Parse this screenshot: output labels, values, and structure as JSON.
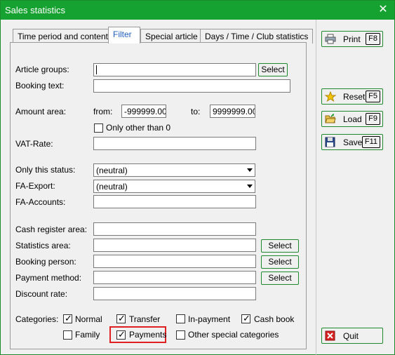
{
  "window": {
    "title": "Sales statistics"
  },
  "tabs": [
    {
      "label": "Time period and content"
    },
    {
      "label": "Filter"
    },
    {
      "label": "Special article"
    },
    {
      "label": "Days / Time / Club statistics"
    }
  ],
  "filter": {
    "article_groups_label": "Article groups:",
    "article_groups_value": "",
    "booking_text_label": "Booking text:",
    "booking_text_value": "",
    "amount_area_label": "Amount area:",
    "from_label": "from:",
    "from_value": "-999999.00",
    "to_label": "to:",
    "to_value": "9999999.00",
    "only_other_than_0_label": "Only other than 0",
    "vat_rate_label": "VAT-Rate:",
    "vat_rate_value": "",
    "only_this_status_label": "Only this status:",
    "only_this_status_value": "(neutral)",
    "fa_export_label": "FA-Export:",
    "fa_export_value": "(neutral)",
    "fa_accounts_label": "FA-Accounts:",
    "fa_accounts_value": "",
    "cash_register_label": "Cash register area:",
    "cash_register_value": "",
    "statistics_area_label": "Statistics area:",
    "statistics_area_value": "",
    "booking_person_label": "Booking person:",
    "booking_person_value": "",
    "payment_method_label": "Payment method:",
    "payment_method_value": "",
    "discount_rate_label": "Discount rate:",
    "discount_rate_value": "",
    "select_label": "Select",
    "categories_label": "Categories:",
    "categories": [
      {
        "label": "Normal",
        "checked": true
      },
      {
        "label": "Transfer",
        "checked": true
      },
      {
        "label": "In-payment",
        "checked": false
      },
      {
        "label": "Cash book",
        "checked": true
      },
      {
        "label": "Family",
        "checked": false
      },
      {
        "label": "Payments",
        "checked": true
      },
      {
        "label": "Other special categories",
        "checked": false
      }
    ]
  },
  "side_buttons": {
    "print": {
      "label": "Print",
      "key": "F8",
      "icon": "printer-icon"
    },
    "reset": {
      "label": "Reset",
      "key": "F5",
      "icon": "star-icon"
    },
    "load": {
      "label": "Load",
      "key": "F9",
      "icon": "folder-open-icon"
    },
    "save": {
      "label": "Save",
      "key": "F11",
      "icon": "floppy-disk-icon"
    },
    "quit": {
      "label": "Quit",
      "icon": "close-x-icon"
    }
  },
  "colors": {
    "titlebar": "#16a230",
    "highlight": "#e02020",
    "active_tab_text": "#1f5fbf"
  }
}
